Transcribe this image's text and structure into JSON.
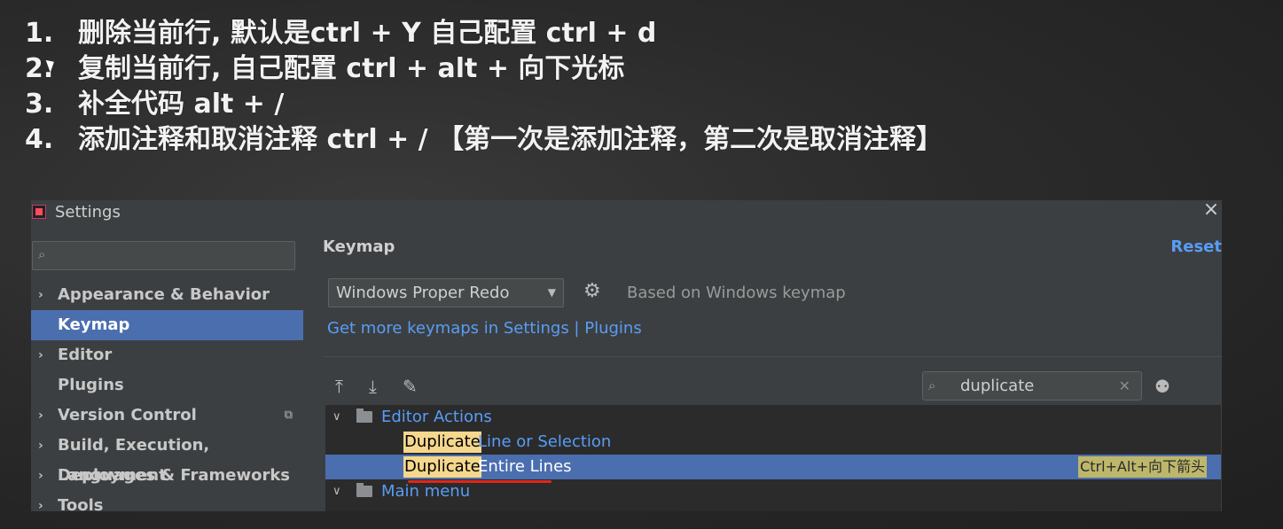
{
  "notes": [
    {
      "num": "1.",
      "text": "删除当前行, 默认是ctrl + Y 自己配置 ctrl + d"
    },
    {
      "num": "2.",
      "text": "复制当前行, 自己配置 ctrl + alt + 向下光标"
    },
    {
      "num": "3.",
      "text": "补全代码  alt + /"
    },
    {
      "num": "4.",
      "text": "添加注释和取消注释 ctrl + / 【第一次是添加注释，第二次是取消注释】"
    }
  ],
  "window": {
    "title": "Settings",
    "close_icon": "×"
  },
  "sidebar": {
    "search_placeholder": "",
    "items": [
      {
        "label": "Appearance & Behavior",
        "chevron": "›"
      },
      {
        "label": "Keymap",
        "chevron": ""
      },
      {
        "label": "Editor",
        "chevron": "›"
      },
      {
        "label": "Plugins",
        "chevron": ""
      },
      {
        "label": "Version Control",
        "chevron": "›"
      },
      {
        "label": "Build, Execution, Deployment",
        "chevron": "›"
      },
      {
        "label": "Languages & Frameworks",
        "chevron": "›"
      },
      {
        "label": "Tools",
        "chevron": "›"
      }
    ],
    "selected": "Keymap"
  },
  "main": {
    "section_title": "Keymap",
    "reset_label": "Reset",
    "keymap_select": "Windows Proper Redo",
    "based_on": "Based on Windows keymap",
    "more_link": "Get more keymaps in Settings | Plugins",
    "search_value": "duplicate",
    "tree": {
      "group1": "Editor Actions",
      "item1_highlight": "Duplicate",
      "item1_rest": "Line or Selection",
      "item2_highlight": "Duplicate",
      "item2_rest": "Entire Lines",
      "item2_shortcut": "Ctrl+Alt+向下箭头",
      "group2": "Main menu"
    }
  },
  "colors": {
    "selection": "#4b6eaf",
    "link": "#589df6",
    "highlight": "#f5d78e",
    "shortcut_bg": "#bdb76b",
    "annotation_red": "#e0261b"
  }
}
